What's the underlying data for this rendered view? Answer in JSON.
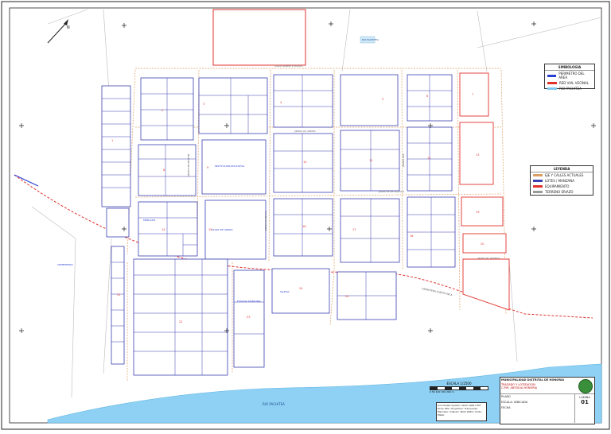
{
  "map": {
    "labels": {
      "river": "RIO PACHITEA",
      "river_upper": "RIO PACHITEA",
      "school": "INSTITUCION EDUCATIVA",
      "plaza": "PLAZA DE ARMAS",
      "stadium": "ESTADIO MUNICIPAL",
      "church": "IGLESIA",
      "market": "MERCADO",
      "cemetery": "CEMENTERIO",
      "north": "N"
    },
    "streets": {
      "h1": "CALLE ALBERTO ROSAS",
      "h2": "JIRON LOS ANDES",
      "h3": "JIRON 28 DE AGOSTO",
      "h4": "JIRON DEL PUERTO",
      "v1": "JIRON SAN MARTIN",
      "v2": "JIRON HUANUCO",
      "v3": "JIRON LIMA",
      "road": "CARRETERA PUERTO INCA"
    },
    "legend_symbology": {
      "title": "SIMBOLOGIA",
      "items": [
        {
          "label": "PERIMETRO DEL AREA",
          "color": "#2a3fd1"
        },
        {
          "label": "RED VIAL VECINAL",
          "color": "#e0322c"
        },
        {
          "label": "RIO PACHITEA",
          "color": "#7ec8f0"
        }
      ]
    },
    "legend_general": {
      "title": "LEYENDA",
      "items": [
        {
          "label": "EJE Y CALLES ACTUALES",
          "color": "#d9a066"
        },
        {
          "label": "LOTES / MANZANA",
          "color": "#3b3fb0"
        },
        {
          "label": "EQUIPAMIENTO",
          "color": "#e0322c"
        },
        {
          "label": "TERRENO ERIAZO",
          "color": "#999999"
        }
      ]
    },
    "scale": {
      "label": "ESCALA 1/2500",
      "bar_text": "0 50 100 150 200 m"
    },
    "note_box": "Coordinate System: WGS 1984 UTM Zone 18S / Projection: Transverse Mercator / Datum: WGS 1984 / Units: Meter",
    "title_block": {
      "institution": "MUNICIPALIDAD DISTRITAL DE HONORIA",
      "project": "TRAZADO Y LOTIZACION",
      "place": "C.P.M. ANTIGUA HONORIA",
      "sheet_label": "LAMINA",
      "sheet_number": "01",
      "plan_label": "PLANO",
      "scale_label": "ESCALA: INDICADA",
      "date_label": "FECHA",
      "logo": "regional-logo"
    },
    "colors": {
      "river": "#8fd1f4",
      "block": "#3b3fb0",
      "equip": "#e0322c",
      "street": "#d9a066",
      "road": "#e0322c"
    }
  }
}
